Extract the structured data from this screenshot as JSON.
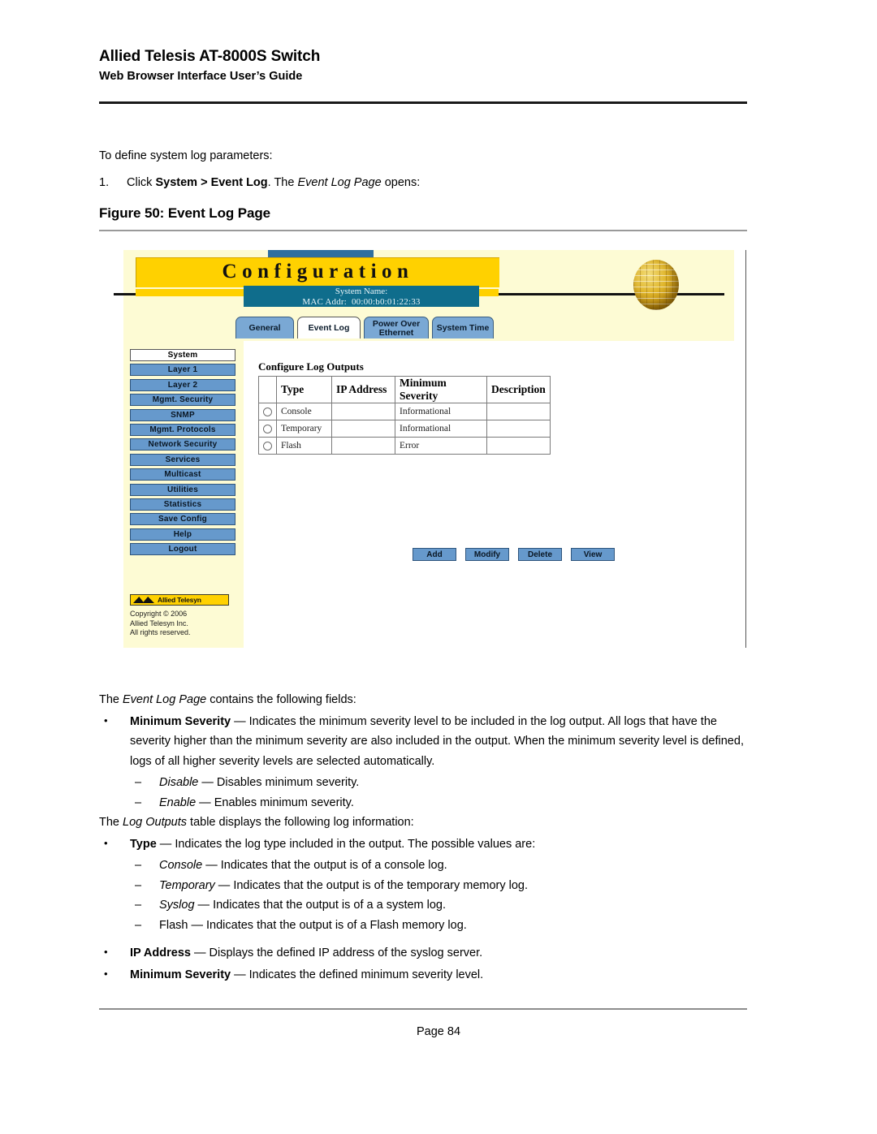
{
  "document": {
    "title": "Allied Telesis AT-8000S Switch",
    "subtitle": "Web Browser Interface User’s Guide",
    "page_number": "Page 84"
  },
  "intro": {
    "lead": "To define system log parameters:",
    "step_number": "1.",
    "step_prefix": "Click ",
    "step_bold": "System > Event Log",
    "step_mid": ". The ",
    "step_italic": "Event Log Page",
    "step_suffix": " opens:",
    "figure_caption": "Figure 50:  Event Log Page"
  },
  "app": {
    "banner_title": "Configuration",
    "system_name_label": "System Name:",
    "mac_label": "MAC Addr:",
    "mac_value": "00:00:b0:01:22:33",
    "tabs": [
      {
        "label": "General",
        "active": false
      },
      {
        "label": "Event Log",
        "active": true
      },
      {
        "label": "Power Over Ethernet",
        "line1": "Power Over",
        "line2": "Ethernet",
        "active": false
      },
      {
        "label": "System Time",
        "active": false
      }
    ],
    "sidebar": [
      {
        "label": "System",
        "selected": true
      },
      {
        "label": "Layer 1",
        "selected": false
      },
      {
        "label": "Layer 2",
        "selected": false
      },
      {
        "label": "Mgmt. Security",
        "selected": false
      },
      {
        "label": "SNMP",
        "selected": false
      },
      {
        "label": "Mgmt. Protocols",
        "selected": false
      },
      {
        "label": "Network Security",
        "selected": false
      },
      {
        "label": "Services",
        "selected": false
      },
      {
        "label": "Multicast",
        "selected": false
      },
      {
        "label": "Utilities",
        "selected": false
      },
      {
        "label": "Statistics",
        "selected": false
      },
      {
        "label": "Save Config",
        "selected": false
      },
      {
        "label": "Help",
        "selected": false
      },
      {
        "label": "Logout",
        "selected": false
      }
    ],
    "logo_text": "Allied Telesyn",
    "copyright_line1": "Copyright © 2006",
    "copyright_line2": "Allied Telesyn Inc.",
    "copyright_line3": "All rights reserved.",
    "panel": {
      "title": "Configure Log Outputs",
      "columns": [
        "",
        "Type",
        "IP Address",
        "Minimum Severity",
        "Description"
      ],
      "rows": [
        {
          "type": "Console",
          "ip": "",
          "severity": "Informational",
          "description": ""
        },
        {
          "type": "Temporary",
          "ip": "",
          "severity": "Informational",
          "description": ""
        },
        {
          "type": "Flash",
          "ip": "",
          "severity": "Error",
          "description": ""
        }
      ],
      "buttons": [
        "Add",
        "Modify",
        "Delete",
        "View"
      ]
    },
    "colors": {
      "banner_yellow": "#ffd100",
      "cream": "#fdfbd4",
      "button_blue": "#6699cc",
      "tab_blue": "#7aa8d4",
      "sysbar_teal": "#0f6d8c"
    }
  },
  "body": {
    "p1_a": "The ",
    "p1_i": "Event Log Page",
    "p1_b": " contains the following fields:",
    "b1_bold": "Minimum Severity",
    "b1_text": " — Indicates the minimum severity level to be included in the log output. All logs that have the severity higher than the minimum severity are also included in the output. When the minimum severity level is defined, logs of all higher severity levels are selected automatically.",
    "d1_i": "Disable",
    "d1_text": " — Disables minimum severity.",
    "d2_i": "Enable",
    "d2_text": " — Enables minimum severity.",
    "p2_a": "The ",
    "p2_i": "Log Outputs",
    "p2_b": " table displays the following log information:",
    "b2_bold": "Type",
    "b2_text": " — Indicates the log type included in the output. The possible values are:",
    "d3_i": "Console",
    "d3_text": " — Indicates that the output is of a console log.",
    "d4_i": "Temporary",
    "d4_text": " — Indicates that the output is of the temporary memory log.",
    "d5_i": "Syslog",
    "d5_text": " — Indicates that the output is of a a system log.",
    "d6_i": "Flash",
    "d6_text": " — Indicates that the output is of a Flash memory log.",
    "b3_bold": "IP Address",
    "b3_text": " — Displays the defined IP address of the syslog server.",
    "b4_bold": "Minimum Severity",
    "b4_text": " — Indicates the defined minimum severity level."
  }
}
